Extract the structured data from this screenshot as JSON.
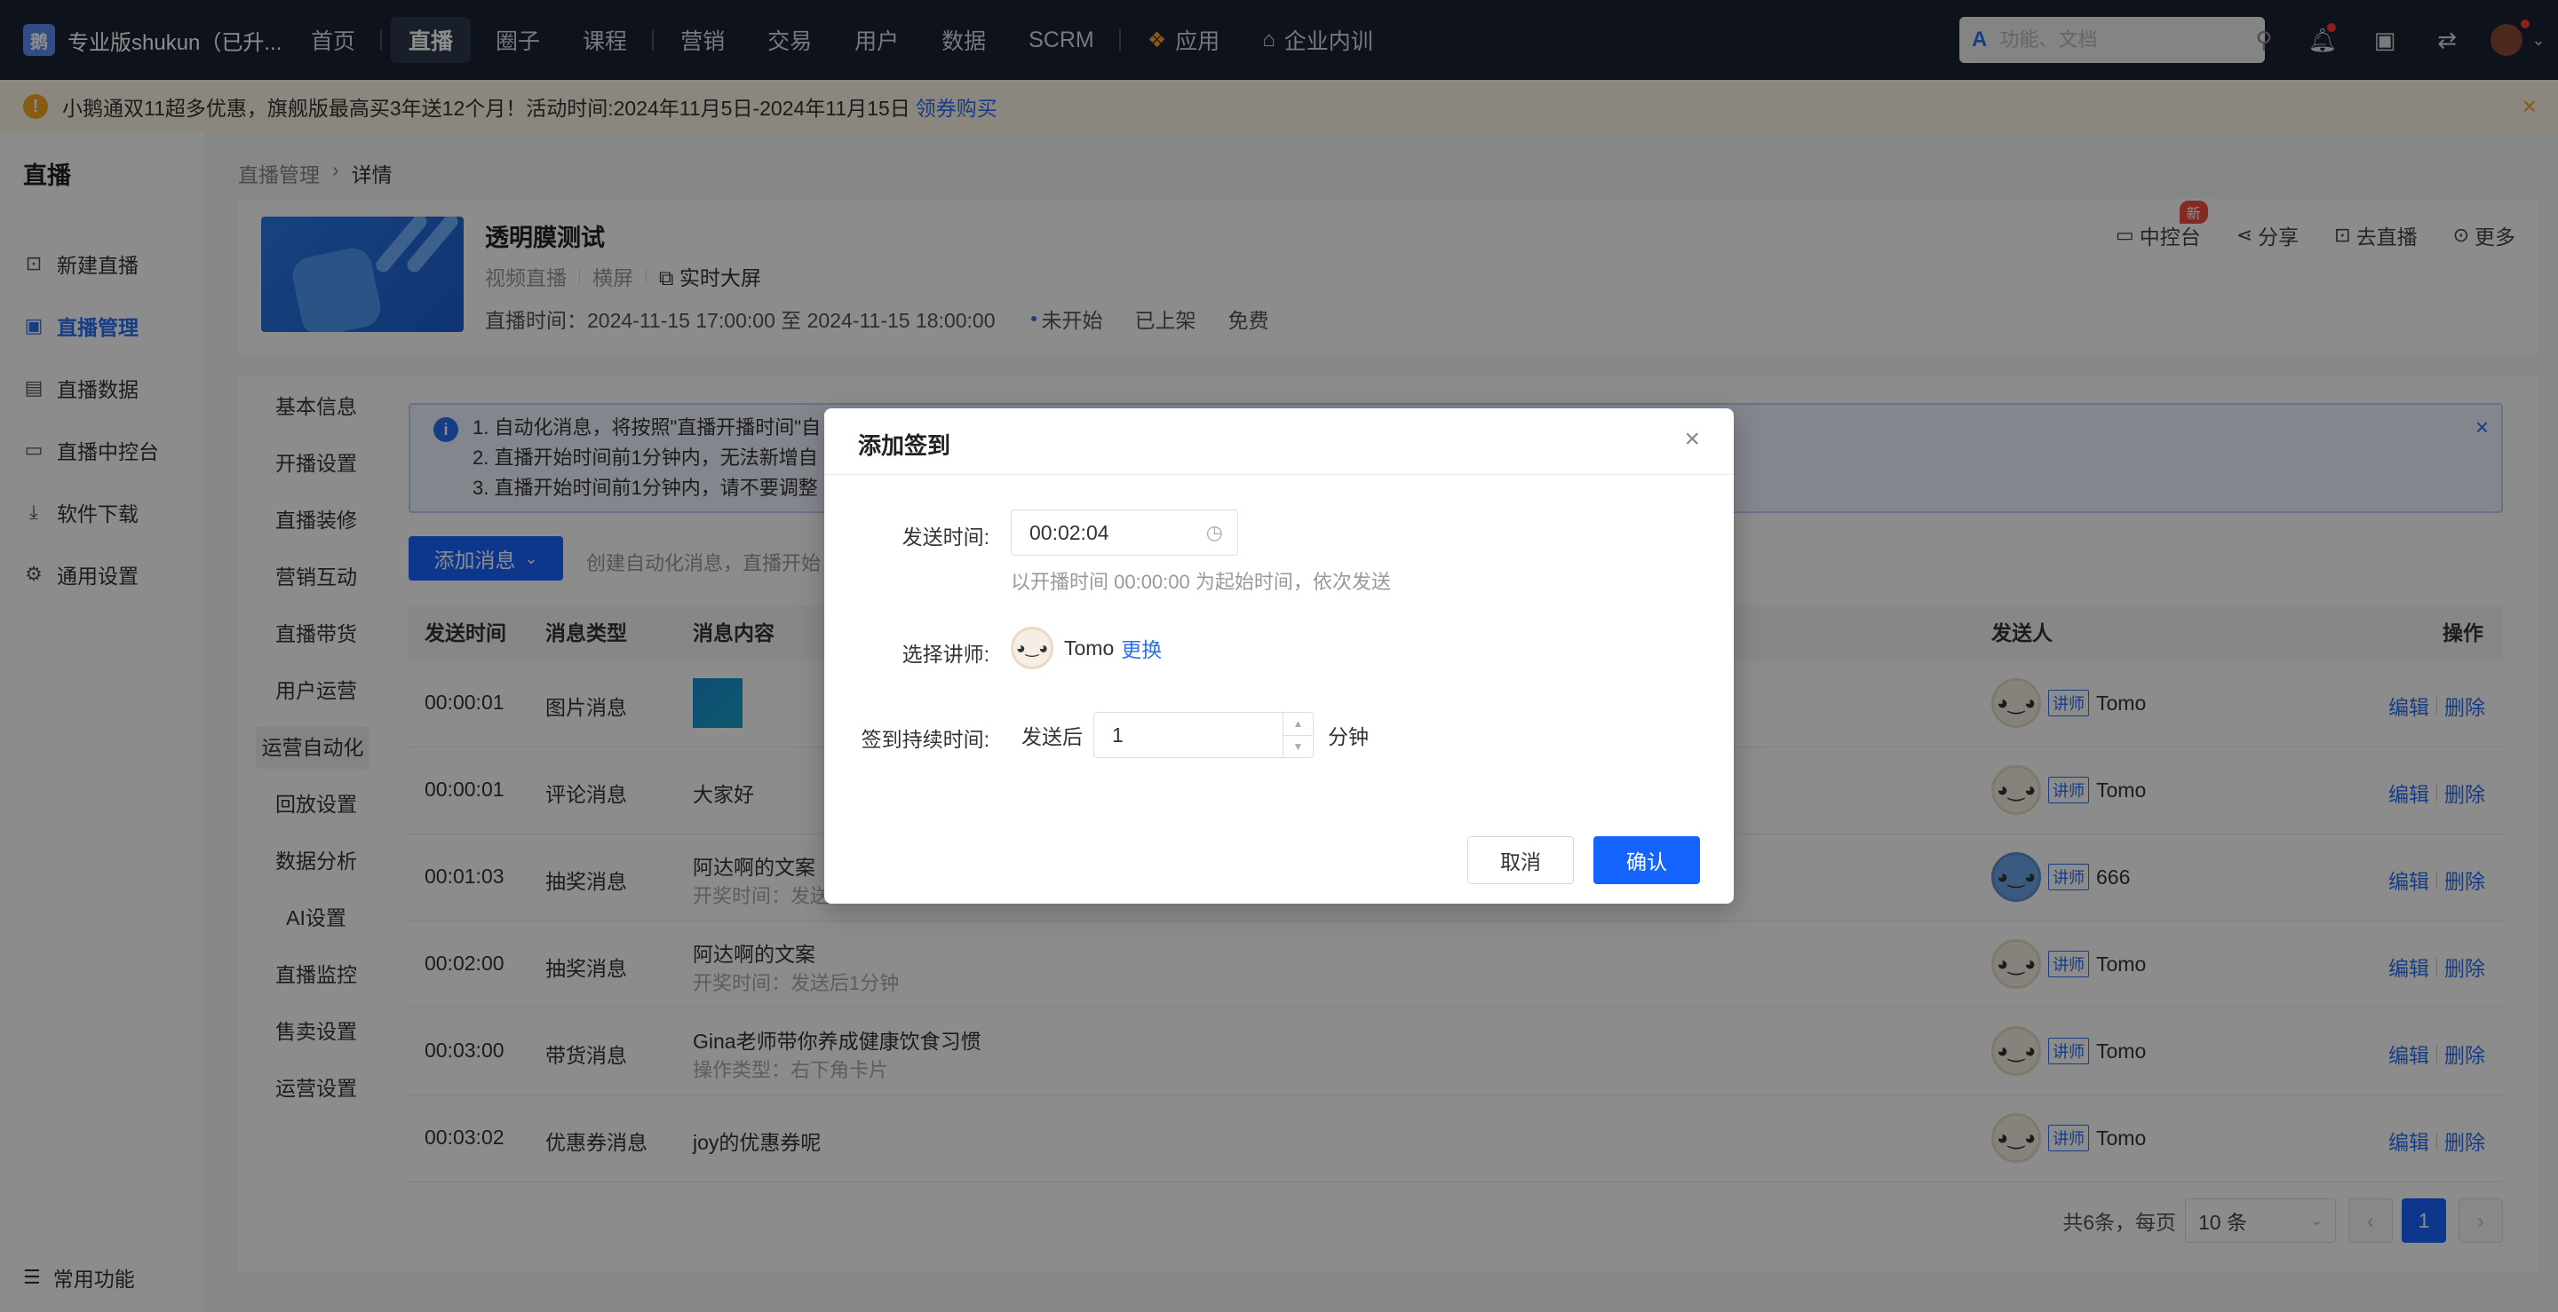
{
  "topnav": {
    "brand_logo": "鹅",
    "brand_name": "专业版shukun（已升...",
    "items": [
      {
        "label": "首页"
      },
      {
        "label": "直播"
      },
      {
        "label": "圈子"
      },
      {
        "label": "课程"
      },
      {
        "label": "营销"
      },
      {
        "label": "交易"
      },
      {
        "label": "用户"
      },
      {
        "label": "数据"
      },
      {
        "label": "SCRM"
      },
      {
        "label": "应用"
      },
      {
        "label": "企业内训"
      }
    ],
    "search_placeholder": "功能、文档",
    "active_color": "#2f3a4e"
  },
  "notice": {
    "text": "小鹅通双11超多优惠，旗舰版最高买3年送12个月！活动时间:2024年11月5日-2024年11月15日",
    "link": "领券购买",
    "color": "#fdf5e6"
  },
  "sidebar": {
    "title": "直播",
    "items": [
      {
        "label": "新建直播",
        "icon": "video-plus-icon"
      },
      {
        "label": "直播管理",
        "icon": "manage-icon"
      },
      {
        "label": "直播数据",
        "icon": "chart-icon"
      },
      {
        "label": "直播中控台",
        "icon": "monitor-icon"
      },
      {
        "label": "软件下载",
        "icon": "download-icon"
      },
      {
        "label": "通用设置",
        "icon": "gear-icon"
      }
    ],
    "common": "常用功能"
  },
  "breadcrumb": {
    "parent": "直播管理",
    "current": "详情"
  },
  "live": {
    "title": "透明膜测试",
    "type": "视频直播",
    "orientation": "横屏",
    "screen": "实时大屏",
    "time": "直播时间：2024-11-15 17:00:00 至 2024-11-15 18:00:00",
    "status": "未开始",
    "shelf": "已上架",
    "price": "免费",
    "actions": {
      "console": "中控台",
      "new": "新",
      "share": "分享",
      "golive": "去直播",
      "more": "更多"
    }
  },
  "submenu": [
    "基本信息",
    "开播设置",
    "直播装修",
    "营销互动",
    "直播带货",
    "用户运营",
    "运营自动化",
    "回放设置",
    "数据分析",
    "AI设置",
    "直播监控",
    "售卖设置",
    "运营设置"
  ],
  "alert": {
    "lines": [
      "1. 自动化消息，将按照\"直播开播时间\"自",
      "2. 直播开始时间前1分钟内，无法新增自",
      "3. 直播开始时间前1分钟内，请不要调整"
    ]
  },
  "toolbar": {
    "add_label": "添加消息",
    "hint": "创建自动化消息，直播开始"
  },
  "table": {
    "headers": {
      "time": "发送时间",
      "type": "消息类型",
      "content": "消息内容",
      "sender": "发送人",
      "ops": "操作"
    },
    "rows": [
      {
        "time": "00:00:01",
        "type": "图片消息",
        "content": "",
        "sub": "",
        "image": true,
        "sender": "Tomo",
        "role": "讲师"
      },
      {
        "time": "00:00:01",
        "type": "评论消息",
        "content": "大家好",
        "sub": "",
        "image": false,
        "sender": "Tomo",
        "role": "讲师"
      },
      {
        "time": "00:01:03",
        "type": "抽奖消息",
        "content": "阿达啊的文案",
        "sub": "开奖时间：发送",
        "image": false,
        "sender": "666",
        "role": "讲师"
      },
      {
        "time": "00:02:00",
        "type": "抽奖消息",
        "content": "阿达啊的文案",
        "sub": "开奖时间：发送后1分钟",
        "image": false,
        "sender": "Tomo",
        "role": "讲师"
      },
      {
        "time": "00:03:00",
        "type": "带货消息",
        "content": "Gina老师带你养成健康饮食习惯",
        "sub": "操作类型：右下角卡片",
        "image": false,
        "sender": "Tomo",
        "role": "讲师"
      },
      {
        "time": "00:03:02",
        "type": "优惠券消息",
        "content": "joy的优惠券呢",
        "sub": "",
        "image": false,
        "sender": "Tomo",
        "role": "讲师"
      }
    ],
    "edit": "编辑",
    "delete": "删除"
  },
  "pager": {
    "total": "共6条，每页",
    "size": "10 条",
    "page": "1"
  },
  "modal": {
    "title": "添加签到",
    "send_time_label": "发送时间:",
    "send_time_value": "00:02:04",
    "hint": "以开播时间 00:00:00 为起始时间，依次发送",
    "lecturer_label": "选择讲师:",
    "lecturer_name": "Tomo",
    "change": "更换",
    "duration_label": "签到持续时间:",
    "after_send": "发送后",
    "duration_value": "1",
    "unit": "分钟",
    "cancel": "取消",
    "confirm": "确认",
    "primary_color": "#1664ff"
  }
}
